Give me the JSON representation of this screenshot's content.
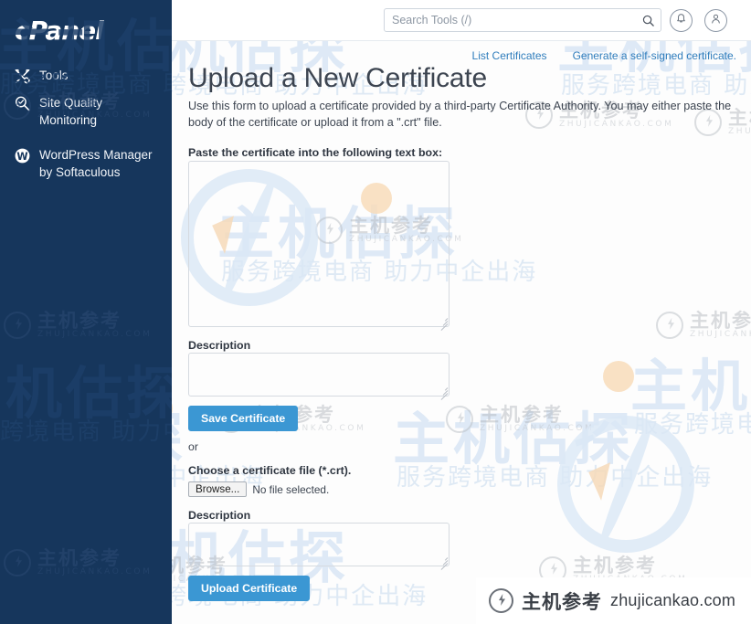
{
  "brand": {
    "logo_text": "cPanel"
  },
  "sidebar": {
    "items": [
      {
        "label": "Tools",
        "icon": "tools-icon"
      },
      {
        "label": "Site Quality Monitoring",
        "icon": "magnifier-check-icon"
      },
      {
        "label": "WordPress Manager by Softaculous",
        "icon": "wordpress-icon"
      }
    ]
  },
  "topbar": {
    "search_placeholder": "Search Tools (/)",
    "search_value": "",
    "search_icon": "search-icon",
    "bell_icon": "bell-icon",
    "user_icon": "user-icon"
  },
  "links": [
    {
      "label": "List Certificates"
    },
    {
      "label": "Generate a self-signed certificate."
    }
  ],
  "main": {
    "title": "Upload a New Certificate",
    "description": "Use this form to upload a certificate provided by a third-party Certificate Authority. You may either paste the body of the certificate or upload it from a \".crt\" file.",
    "paste_label": "Paste the certificate into the following text box:",
    "paste_value": "",
    "description_label_1": "Description",
    "description_value_1": "",
    "save_button": "Save Certificate",
    "or_text": "or",
    "choose_file_label": "Choose a certificate file (*.crt).",
    "browse_button": "Browse...",
    "file_status": "No file selected.",
    "description_label_2": "Description",
    "description_value_2": "",
    "upload_button": "Upload Certificate"
  },
  "watermarks": {
    "big_text": "主机估探",
    "sub_text": "服务跨境电商 助力中企出海",
    "mark_cn": "主机参考",
    "mark_en": "ZHUJICANKAO.COM"
  },
  "badge": {
    "cn": "主机参考",
    "en": "zhujicankao.com",
    "icon": "zhujicankao-logo-icon"
  },
  "colors": {
    "sidebar_bg": "#16365c",
    "accent_button": "#3b97d3",
    "link": "#2f7dbc",
    "watermark_blue": "#d9e6f5"
  }
}
